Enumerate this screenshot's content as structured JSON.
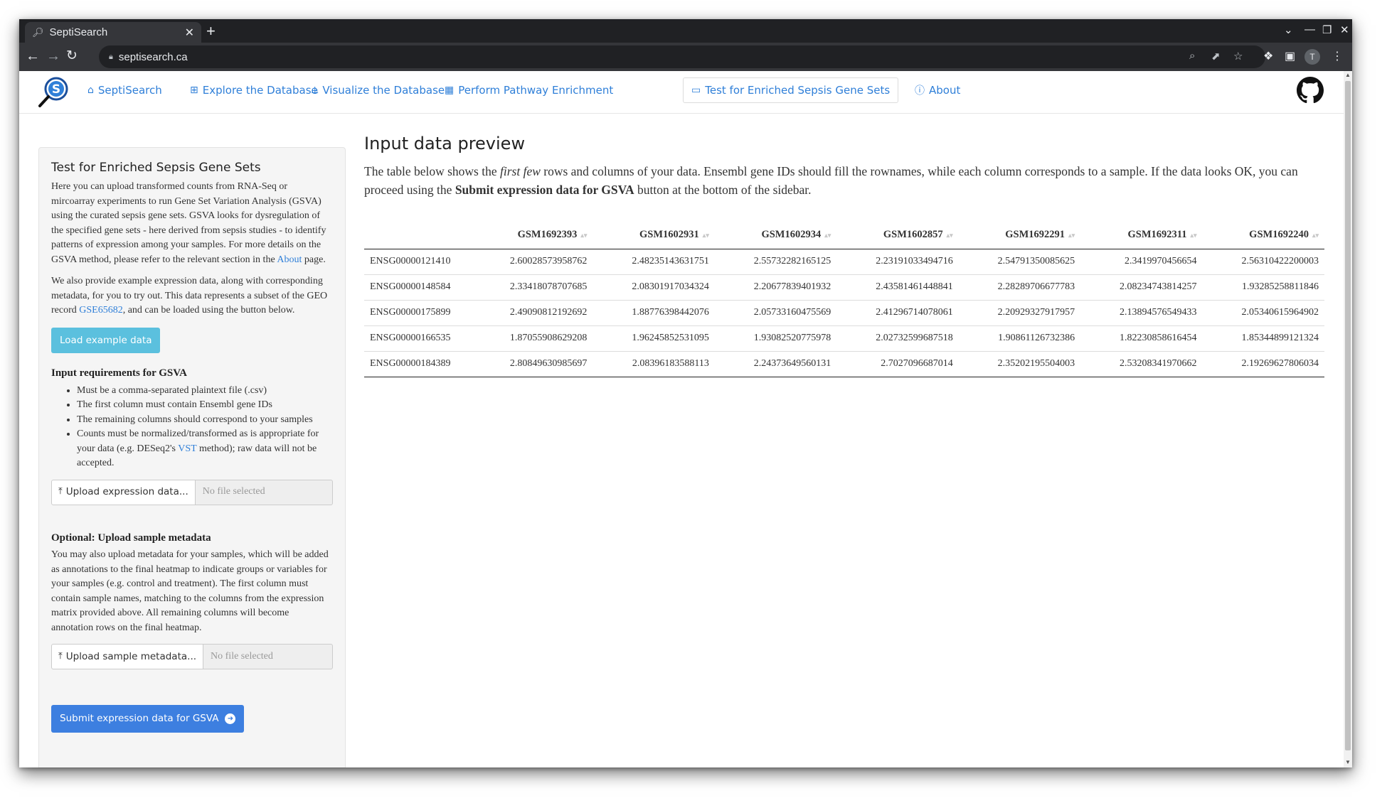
{
  "browser": {
    "tab_title": "SeptiSearch",
    "url": "septisearch.ca"
  },
  "navbar": {
    "items": [
      {
        "label": "SeptiSearch",
        "icon": "home-icon"
      },
      {
        "label": "Explore the Database",
        "icon": "table-icon"
      },
      {
        "label": "Visualize the Database",
        "icon": "chart-icon"
      },
      {
        "label": "Perform Pathway Enrichment",
        "icon": "calculator-icon"
      },
      {
        "label": "Test for Enriched Sepsis Gene Sets",
        "icon": "presentation-icon"
      },
      {
        "label": "About",
        "icon": "info-icon"
      }
    ],
    "active_index": 4
  },
  "sidebar": {
    "title": "Test for Enriched Sepsis Gene Sets",
    "p1_text": "Here you can upload transformed counts from RNA-Seq or mircoarray experiments to run Gene Set Variation Analysis (GSVA) using the curated sepsis gene sets. GSVA looks for dysregulation of the specified gene sets - here derived from sepsis studies - to identify patterns of expression among your samples. For more details on the GSVA method, please refer to the relevant section in the ",
    "p1_link": "About",
    "p1_end": " page.",
    "p2_text": "We also provide example expression data, along with corresponding metadata, for you to try out. This data represents a subset of the GEO record ",
    "p2_link": "GSE65682",
    "p2_end": ", and can be loaded using the button below.",
    "load_example_label": "Load example data",
    "req_title": "Input requirements for GSVA",
    "req_items": [
      "Must be a comma-separated plaintext file (.csv)",
      "The first column must contain Ensembl gene IDs",
      "The remaining columns should correspond to your samples"
    ],
    "req_item4_text": "Counts must be normalized/transformed as is appropriate for your data (e.g. DESeq2's ",
    "req_item4_link": "VST",
    "req_item4_end": " method); raw data will not be accepted.",
    "upload_expr_label": "Upload expression data...",
    "upload_expr_status": "No file selected",
    "optional_title": "Optional: Upload sample metadata",
    "optional_text": "You may also upload metadata for your samples, which will be added as annotations to the final heatmap to indicate groups or variables for your samples (e.g. control and treatment). The first column must contain sample names, matching to the columns from the expression matrix provided above. All remaining columns will become annotation rows on the final heatmap.",
    "upload_meta_label": "Upload sample metadata...",
    "upload_meta_status": "No file selected",
    "submit_label": "Submit expression data for GSVA"
  },
  "main": {
    "heading": "Input data preview",
    "intro_a": "The table below shows the ",
    "intro_em": "first few",
    "intro_b": " rows and columns of your data. Ensembl gene IDs should fill the rownames, while each column corresponds to a sample. If the data looks OK, you can proceed using the ",
    "intro_strong": "Submit expression data for GSVA",
    "intro_c": " button at the bottom of the sidebar.",
    "table": {
      "columns": [
        "",
        "GSM1692393",
        "GSM1602931",
        "GSM1602934",
        "GSM1602857",
        "GSM1692291",
        "GSM1692311",
        "GSM1692240"
      ],
      "rows": [
        [
          "ENSG00000121410",
          "2.60028573958762",
          "2.48235143631751",
          "2.55732282165125",
          "2.23191033494716",
          "2.54791350085625",
          "2.3419970456654",
          "2.56310422200003"
        ],
        [
          "ENSG00000148584",
          "2.33418078707685",
          "2.08301917034324",
          "2.20677839401932",
          "2.43581461448841",
          "2.28289706677783",
          "2.08234743814257",
          "1.93285258811846"
        ],
        [
          "ENSG00000175899",
          "2.49090812192692",
          "1.88776398442076",
          "2.05733160475569",
          "2.41296714078061",
          "2.20929327917957",
          "2.13894576549433",
          "2.05340615964902"
        ],
        [
          "ENSG00000166535",
          "1.87055908629208",
          "1.96245852531095",
          "1.93082520775978",
          "2.02732599687518",
          "1.90861126732386",
          "1.82230858616454",
          "1.85344899121324"
        ],
        [
          "ENSG00000184389",
          "2.80849630985697",
          "2.08396183588113",
          "2.24373649560131",
          "2.7027096687014",
          "2.35202195504003",
          "2.53208341970662",
          "2.19269627806034"
        ]
      ]
    }
  }
}
